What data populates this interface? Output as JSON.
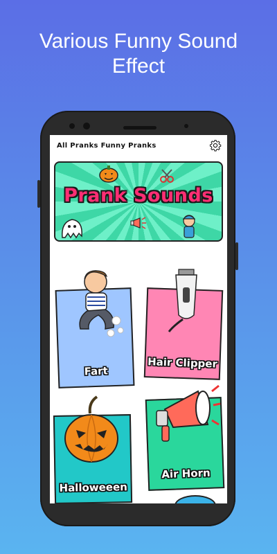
{
  "promo": {
    "title_line1": "Various Funny Sound",
    "title_line2": "Effect"
  },
  "app_bar": {
    "title": "All Pranks Funny Pranks",
    "settings_icon": "gear-icon"
  },
  "banner": {
    "title": "Prank Sounds",
    "icons": [
      "pumpkin-icon",
      "scissors-icon",
      "ghost-icon",
      "megaphone-icon",
      "boy-icon"
    ]
  },
  "categories": [
    {
      "label": "Fart",
      "color": "#9fc6ff",
      "icon": "boy-icon"
    },
    {
      "label": "Hair Clipper",
      "color": "#ff86b4",
      "icon": "hair-clipper-icon"
    },
    {
      "label": "Halloweeen",
      "color": "#22c8c8",
      "icon": "pumpkin-icon"
    },
    {
      "label": "Air Horn",
      "color": "#2ad79c",
      "icon": "air-horn-icon"
    }
  ],
  "colors": {
    "background_top": "#5b6ee6",
    "background_bottom": "#5ab4f0",
    "banner_text": "#ff2e74",
    "banner_bg": "#3ed7a6"
  }
}
